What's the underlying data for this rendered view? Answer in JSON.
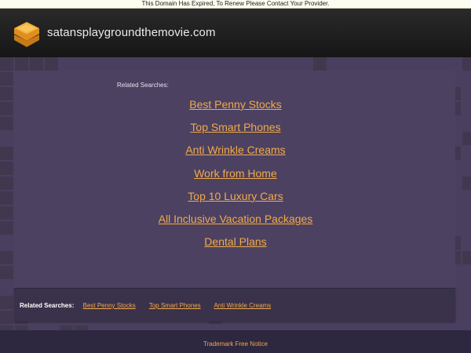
{
  "notice": {
    "text": "This Domain Has Expired, To Renew Please Contact Your Provider."
  },
  "header": {
    "logo_icon": "orange-stacked-layers-icon",
    "domain": "satansplaygroundthemovie.com"
  },
  "main": {
    "related_heading": "Related Searches:",
    "links": [
      "Best Penny Stocks",
      "Top Smart Phones",
      "Anti Wrinkle Creams",
      "Work from Home",
      "Top 10 Luxury Cars",
      "All Inclusive Vacation Packages",
      "Dental Plans"
    ]
  },
  "bottom": {
    "label": "Related Searches:",
    "links": [
      "Best Penny Stocks",
      "Top Smart Phones",
      "Anti Wrinkle Creams"
    ]
  },
  "footer": {
    "link": "Trademark Free Notice"
  },
  "colors": {
    "background": "#4a3f5e",
    "header": "#1e1e1e",
    "link": "#f2a94a",
    "logo": "#f0a030"
  }
}
